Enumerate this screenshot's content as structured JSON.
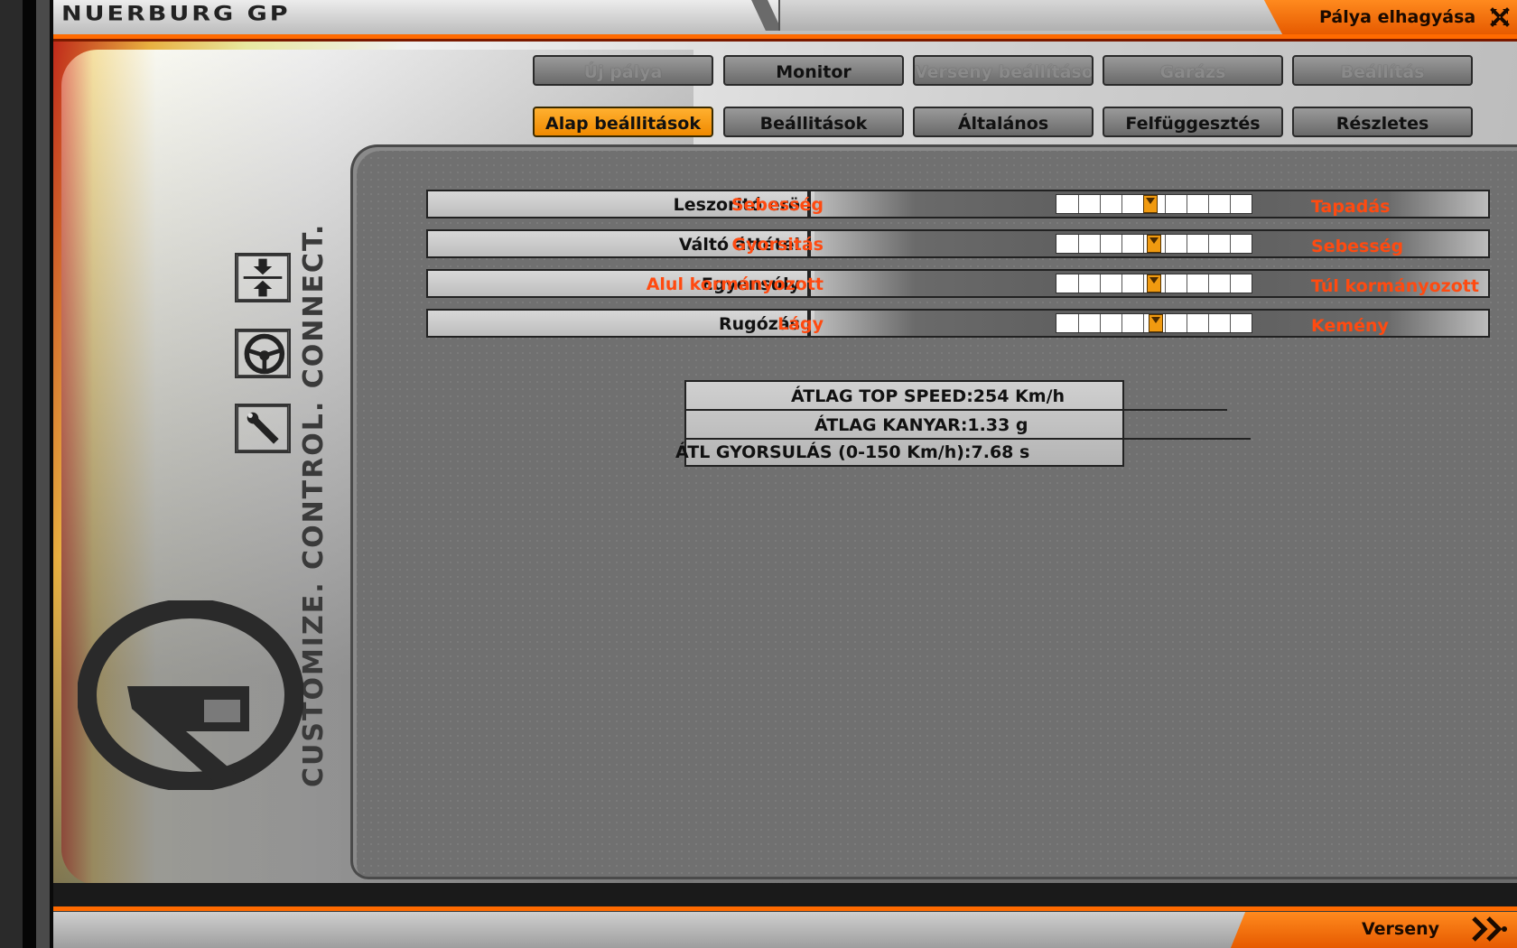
{
  "header": {
    "track_title": "NUERBURG GP",
    "exit_label": "Pálya elhagyása",
    "exit_icon": "close-x-icon"
  },
  "nav_tabs": [
    {
      "label": "Új pálya",
      "state": "disabled"
    },
    {
      "label": "Monitor",
      "state": "enabled"
    },
    {
      "label": "Verseny beállítások",
      "state": "disabled"
    },
    {
      "label": "Garázs",
      "state": "disabled"
    },
    {
      "label": "Beállítás",
      "state": "disabled"
    }
  ],
  "sub_tabs": [
    {
      "label": "Alap beállitások",
      "state": "active"
    },
    {
      "label": "Beállitások",
      "state": "enabled"
    },
    {
      "label": "Általános",
      "state": "enabled"
    },
    {
      "label": "Felfüggesztés",
      "state": "enabled"
    },
    {
      "label": "Részletes",
      "state": "enabled"
    }
  ],
  "side": {
    "icons": [
      "compress-arrows-icon",
      "steering-wheel-icon",
      "wrench-icon"
    ],
    "tagline": "CUSTOMIZE. CONTROL. CONNECT.",
    "logo": "r-logo-icon"
  },
  "settings": [
    {
      "label": "Leszoritó erö",
      "left": "Sebesség",
      "right": "Tapadás",
      "value_fraction": 0.48
    },
    {
      "label": "Váltó áttétel",
      "left": "Gyorsitás",
      "right": "Sebesség",
      "value_fraction": 0.5
    },
    {
      "label": "Egyensúly",
      "left": "Alul kormányozott",
      "right": "Túl kormányozott",
      "value_fraction": 0.5
    },
    {
      "label": "Rugózás",
      "left": "Lágy",
      "right": "Kemény",
      "value_fraction": 0.51
    }
  ],
  "stats": [
    {
      "text": "ÁTLAG TOP SPEED:254 Km/h"
    },
    {
      "text": "ÁTLAG KANYAR:1.33 g"
    },
    {
      "text": "ÁTL GYORSULÁS (0-150 Km/h):7.68 s"
    }
  ],
  "footer": {
    "race_label": "Verseny",
    "race_icon": "double-chevron-right-icon"
  },
  "colors": {
    "accent_orange": "#ff6a00",
    "active_tab": "#f09a10",
    "slider_label": "#ff4a10"
  }
}
